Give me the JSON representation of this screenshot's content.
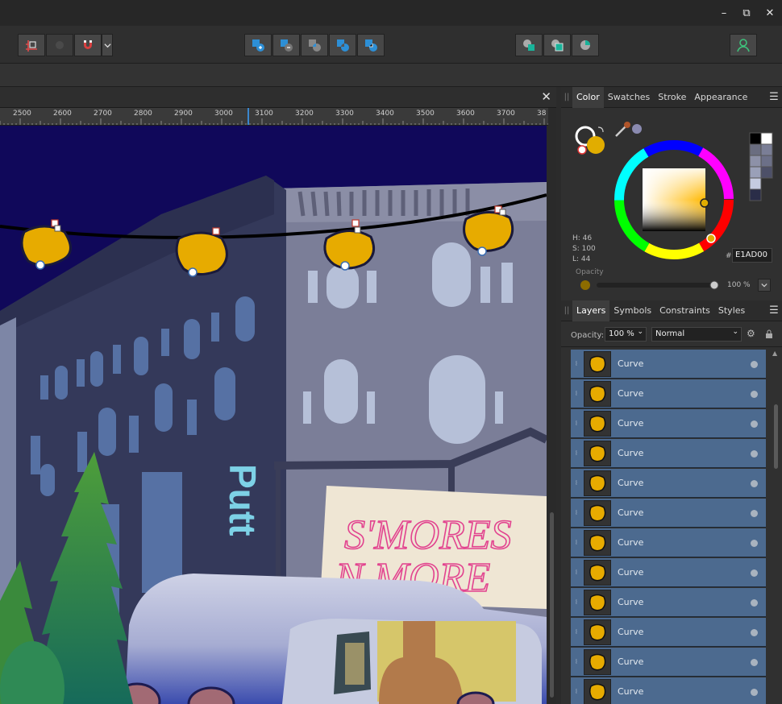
{
  "window": {
    "minimize_glyph": "–",
    "restore_glyph": "⧉",
    "close_glyph": "✕"
  },
  "toolbar": {
    "groups": [
      {
        "name": "snapping",
        "buttons": [
          "snapping-icon",
          "snapping-options-icon",
          "magnet-icon"
        ],
        "dropdown": "chevron-down-icon"
      },
      {
        "name": "boolean-ops",
        "buttons": [
          "add-icon",
          "subtract-icon",
          "intersect-icon",
          "xor-icon",
          "divide-icon"
        ]
      },
      {
        "name": "geometry",
        "buttons": [
          "merge-curves-icon",
          "join-curves-icon",
          "pie-icon"
        ]
      }
    ],
    "personas_icon": "user-icon"
  },
  "document": {
    "close_glyph": "✕"
  },
  "ruler": {
    "labels": [
      "2500",
      "2600",
      "2700",
      "2800",
      "2900",
      "3000",
      "3100",
      "3200",
      "3300",
      "3400",
      "3500",
      "3600",
      "3700",
      "38"
    ]
  },
  "canvas": {
    "sign_line1": "S'MORES",
    "sign_line2": "N MORE",
    "vertical_text": "Putt"
  },
  "color_panel": {
    "tabs": [
      "Color",
      "Swatches",
      "Stroke",
      "Appearance"
    ],
    "active_tab": "Color",
    "h": "H: 46",
    "s": "S: 100",
    "l": "L: 44",
    "hex_label": "#:",
    "hex_value": "E1AD00",
    "opacity_label": "Opacity",
    "opacity_value": "100 %",
    "current_color": "#E1AD00"
  },
  "layers_panel": {
    "tabs": [
      "Layers",
      "Symbols",
      "Constraints",
      "Styles"
    ],
    "active_tab": "Layers",
    "opacity_label": "Opacity:",
    "opacity_value": "100 %",
    "blend_mode": "Normal",
    "layers": [
      {
        "name": "Curve"
      },
      {
        "name": "Curve"
      },
      {
        "name": "Curve"
      },
      {
        "name": "Curve"
      },
      {
        "name": "Curve"
      },
      {
        "name": "Curve"
      },
      {
        "name": "Curve"
      },
      {
        "name": "Curve"
      },
      {
        "name": "Curve"
      },
      {
        "name": "Curve"
      },
      {
        "name": "Curve"
      },
      {
        "name": "Curve"
      }
    ]
  }
}
